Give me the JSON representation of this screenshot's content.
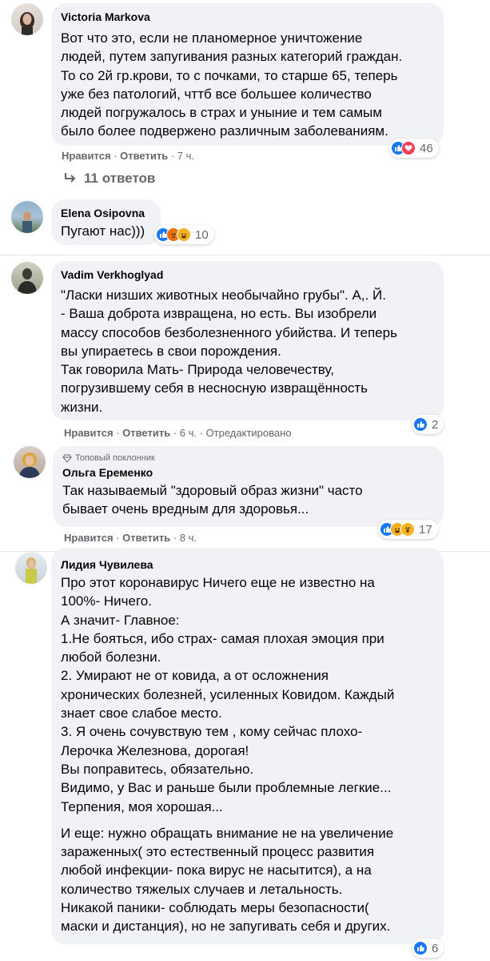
{
  "comments": [
    {
      "author": "Victoria Markova",
      "text": "Вот что это, если не планомерное уничтожение\nлюдей, путем запугивания разных категорий граждан.\nТо со 2й гр.крови, то с почками, то старше 65, теперь\nуже без патологий, чттб все большее количество\nлюдей погружалось в страх и уныние и тем самым\nбыло более подвержено различным заболеваниям.",
      "like": "Нравится",
      "reply": "Ответить",
      "time": "7 ч.",
      "reactions": "46",
      "replies": "11 ответов"
    },
    {
      "author": "Elena Osipovna",
      "text": "Пугают нас)))",
      "reactions": "10"
    },
    {
      "author": "Vadim Verkhoglyad",
      "text": "\"Ласки низших животных необычайно грубы\". А,. Й.\n- Ваша доброта извращена, но есть. Вы изобрели\nмассу способов безболезненного убийства. И теперь\nвы упираетесь в свои порождения.\nТак говорила Мать- Природа человечеству,\nпогрузившему себя в несносную извращённость\nжизни.",
      "like": "Нравится",
      "reply": "Ответить",
      "time": "6 ч.",
      "edited": "Отредактировано",
      "reactions": "2"
    },
    {
      "badge": "Топовый поклонник",
      "author": "Ольга Еременко",
      "text": "Так называемый \"здоровый образ жизни\" часто\nбывает очень вредным для здоровья...",
      "like": "Нравится",
      "reply": "Ответить",
      "time": "8 ч.",
      "reactions": "17"
    },
    {
      "author": "Лидия Чувилева",
      "text": "Про этот коронавирус Ничего еще не известно на\n100%- Ничего.\nА значит- Главное:\n1.Не бояться, ибо страх- самая плохая эмоция при\nлюбой болезни.\n2. Умирают не от ковида, а от осложнения\nхронических болезней, усиленных Ковидом. Каждый\nзнает свое слабое место.\n3. Я очень сочувствую тем , кому сейчас плохо-\nЛерочка Железнова, дорогая!\nВы поправитесь, обязательно.\nВидимо, у Вас и раньше были проблемные легкие...\nТерпения, моя хорошая...",
      "text2": "И еще: нужно обращать внимание не на увеличение\nзараженных( это естественный процесс развития\nлюбой инфекции- пока вирус не насытится), а на\nколичество тяжелых случаев и летальность.\nНикакой паники- соблюдать меры безопасности(\nмаски и дистанция), но не запугивать себя и других.",
      "reactions": "6"
    }
  ],
  "colors": {
    "bubble": "#f0f2f5",
    "meta": "#65676b",
    "like": "#1877f2",
    "love": "#f33e58",
    "haha": "#f7b125",
    "angry": "#e9710f"
  }
}
